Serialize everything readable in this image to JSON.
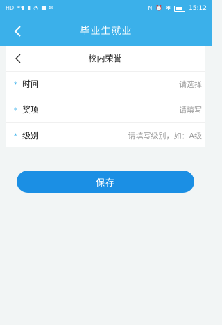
{
  "status_bar": {
    "left_indicators": [
      "HD",
      "4G",
      "signal",
      "wifi",
      "camera",
      "mail"
    ],
    "right_indicators": [
      "N",
      "alarm",
      "bluetooth"
    ],
    "time": "15:12",
    "battery_level": 0.8
  },
  "app_bar": {
    "title": "毕业生就业",
    "back_icon": "chevron-left-icon"
  },
  "sub_header": {
    "title": "校内荣誉",
    "back_icon": "chevron-left-icon"
  },
  "form": {
    "required_mark": "*",
    "fields": [
      {
        "label": "时间",
        "placeholder": "请选择"
      },
      {
        "label": "奖项",
        "placeholder": "请填写"
      },
      {
        "label": "级别",
        "placeholder": "请填写级别，如：A级"
      }
    ]
  },
  "actions": {
    "save_label": "保存"
  },
  "colors": {
    "primary": "#3bb0ea",
    "button": "#1b8fe4",
    "background": "#f2f5f5"
  }
}
